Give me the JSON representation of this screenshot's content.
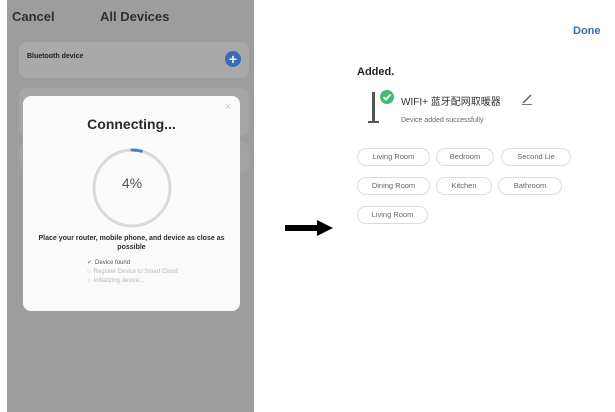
{
  "left_screen": {
    "cancel_label": "Cancel",
    "title": "All Devices",
    "bluetooth_label": "Bluetooth device",
    "plus_symbol": "+",
    "modal": {
      "close_symbol": "×",
      "title": "Connecting...",
      "progress_percent": 4,
      "progress_text": "4%",
      "instruction": "Place your router, mobile phone, and device as close as possible",
      "steps": [
        {
          "label": "Device found",
          "state": "done",
          "marker": "✓"
        },
        {
          "label": "Register Device to Smart Cloud",
          "state": "pending",
          "marker": "○"
        },
        {
          "label": "Initializing device...",
          "state": "pending",
          "marker": "○"
        }
      ]
    }
  },
  "right_screen": {
    "done_label": "Done",
    "added_title": "Added.",
    "device_name": "WIFI+ 蓝牙配网取暖器",
    "device_status": "Device added successfully",
    "rooms": [
      "Living Room",
      "Bedroom",
      "Second Lie",
      "Dining Room",
      "Kitchen",
      "Bathroom",
      "Living Room"
    ]
  },
  "colors": {
    "accent_blue": "#3d6aa8",
    "success_green": "#44b97a",
    "overlay_gray": "#9d9d9d"
  }
}
